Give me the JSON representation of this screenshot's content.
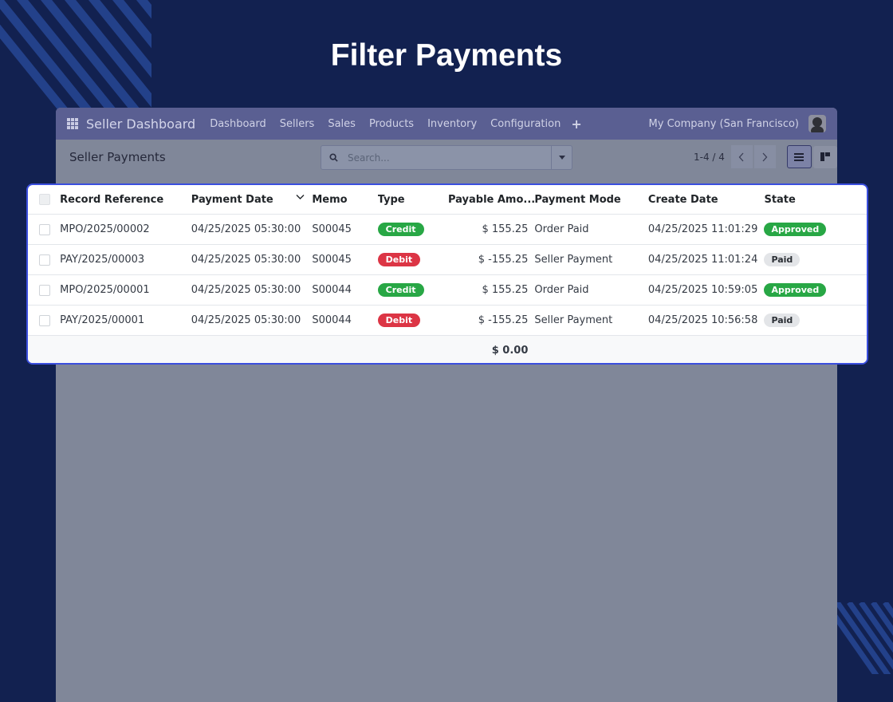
{
  "title": "Filter Payments",
  "navbar": {
    "brand": "Seller Dashboard",
    "menu": [
      "Dashboard",
      "Sellers",
      "Sales",
      "Products",
      "Inventory",
      "Configuration"
    ],
    "plus": "+",
    "company": "My Company (San Francisco)"
  },
  "control": {
    "breadcrumb": "Seller Payments",
    "search_placeholder": "Search...",
    "pager": "1-4 / 4"
  },
  "table": {
    "headers": [
      "Record Reference",
      "Payment Date",
      "Memo",
      "Type",
      "Payable Amo...",
      "Payment Mode",
      "Create Date",
      "State"
    ],
    "rows": [
      {
        "ref": "MPO/2025/00002",
        "pay_date": "04/25/2025 05:30:00",
        "memo": "S00045",
        "type": "Credit",
        "amount": "$ 155.25",
        "mode": "Order Paid",
        "create_date": "04/25/2025 11:01:29",
        "state": "Approved"
      },
      {
        "ref": "PAY/2025/00003",
        "pay_date": "04/25/2025 05:30:00",
        "memo": "S00045",
        "type": "Debit",
        "amount": "$ -155.25",
        "mode": "Seller Payment",
        "create_date": "04/25/2025 11:01:24",
        "state": "Paid"
      },
      {
        "ref": "MPO/2025/00001",
        "pay_date": "04/25/2025 05:30:00",
        "memo": "S00044",
        "type": "Credit",
        "amount": "$ 155.25",
        "mode": "Order Paid",
        "create_date": "04/25/2025 10:59:05",
        "state": "Approved"
      },
      {
        "ref": "PAY/2025/00001",
        "pay_date": "04/25/2025 05:30:00",
        "memo": "S00044",
        "type": "Debit",
        "amount": "$ -155.25",
        "mode": "Seller Payment",
        "create_date": "04/25/2025 10:56:58",
        "state": "Paid"
      }
    ],
    "total": "$ 0.00"
  },
  "colors": {
    "background": "#122150",
    "navbar": "#5a5f92",
    "highlight_border": "#3a4ede",
    "credit": "#28a745",
    "debit": "#dc3545"
  }
}
